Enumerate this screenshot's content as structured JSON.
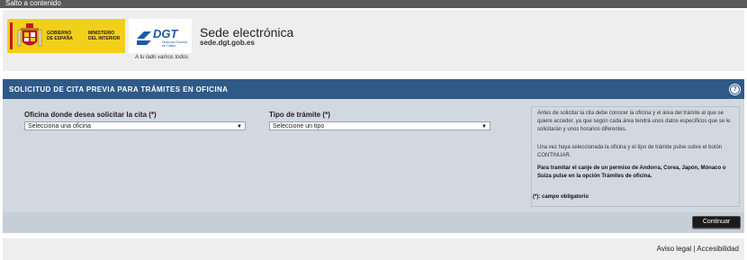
{
  "skip_link": "Salto a contenido",
  "header": {
    "gov_logo": {
      "line1": "GOBIERNO",
      "line2": "DE ESPAÑA",
      "ministry1": "MINISTERIO",
      "ministry2": "DEL INTERIOR"
    },
    "dgt_logo": {
      "text": "DGT",
      "sub1": "Dirección General",
      "sub2": "de Tráfico",
      "tagline": "A tu lado vamos todos"
    },
    "site_title": "Sede electrónica",
    "site_url": "sede.dgt.gob.es"
  },
  "form": {
    "title": "SOLICITUD DE CITA PREVIA PARA TRÁMITES EN OFICINA",
    "help_icon": "?",
    "office_label": "Oficina donde desea solicitar la cita (*)",
    "office_value": "Selecciona una oficina",
    "type_label": "Tipo de trámite (*)",
    "type_value": "Seleccione un tipo",
    "info": {
      "p1": "Antes de solicitar la cita debe conocer la oficina y el área del trámite al que se quiere acceder, ya que según cada área tendrá unos datos específicos que se le solicitarán y unos horarios diferentes.",
      "p2": "Una vez haya seleccionada la oficina y el tipo de trámite pulse sobre el botón CONTINUAR.",
      "p3": "Para tramitar el canje de un permiso de Andorra, Corea, Japón, Mónaco o Suiza pulse en la opción Trámites de oficina."
    },
    "required_note": "(*): campo obligatorio",
    "continue_label": "Continuar"
  },
  "footer": {
    "legal": "Aviso legal",
    "separator": "|",
    "accessibility": "Accesibilidad"
  },
  "colors": {
    "title_bar": "#2f5a87",
    "panel": "#d2d8e0",
    "gov_yellow": "#f2cf1a",
    "dgt_blue": "#1a5aa6"
  }
}
